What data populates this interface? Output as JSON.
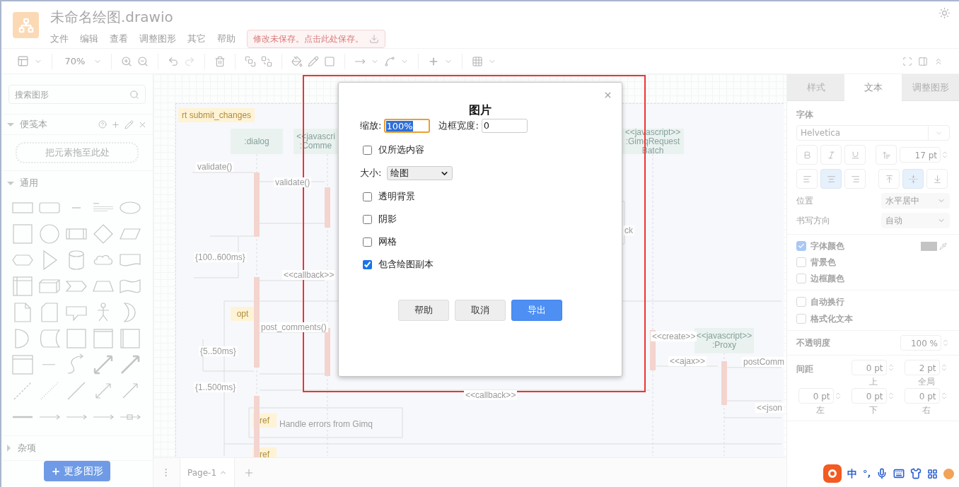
{
  "app": {
    "title": "未命名绘图.drawio",
    "menu": [
      "文件",
      "编辑",
      "查看",
      "调整图形",
      "其它",
      "帮助"
    ],
    "save_notice": "修改未保存。点击此处保存。"
  },
  "toolbar": {
    "zoom": "70%"
  },
  "sidebar": {
    "search": {
      "placeholder": "搜索图形"
    },
    "scratchpad": {
      "title": "便笺本",
      "expanded": true,
      "drop_hint": "把元素拖至此处"
    },
    "sections": [
      {
        "title": "通用",
        "expanded": true
      },
      {
        "title": "杂项",
        "expanded": false
      }
    ],
    "more_shapes": "更多图形"
  },
  "diagram": {
    "frame": "rt submit_changes",
    "participants": [
      {
        "lines": [
          ":dialog"
        ]
      },
      {
        "lines": [
          "<<javascri",
          ":Comme"
        ]
      },
      {
        "lines": [
          "<<javascript>>",
          ":GimqRequest",
          "Batch"
        ]
      },
      {
        "lines": [
          "<<javascript>>",
          ":Proxy"
        ]
      }
    ],
    "fragments": [
      {
        "tag": "opt"
      },
      {
        "tag": "ref",
        "text": "Handle errors from Gimq"
      },
      {
        "tag": "ref"
      }
    ],
    "labels": [
      "validate()",
      "validate()",
      "{100..600ms}",
      "<<callback>>",
      "post_comments()",
      "{5..50ms}",
      "{1..500ms}",
      "<<callback>>",
      "ck",
      "<<create>>",
      "<<ajax>>",
      "postComm",
      "<<json"
    ]
  },
  "pages": [
    {
      "label": "Page-1",
      "selected": true
    }
  ],
  "format_panel": {
    "tabs": [
      {
        "label": "样式",
        "selected": false
      },
      {
        "label": "文本",
        "selected": true
      },
      {
        "label": "调整图形",
        "selected": false
      }
    ],
    "font": {
      "title": "字体",
      "family": "Helvetica",
      "size": "17 pt"
    },
    "align": [
      {
        "kind": "left",
        "selected": false
      },
      {
        "kind": "center",
        "selected": true
      },
      {
        "kind": "right",
        "selected": false
      }
    ],
    "valign": [
      {
        "kind": "top",
        "selected": false
      },
      {
        "kind": "middle",
        "selected": true
      },
      {
        "kind": "bottom",
        "selected": false
      }
    ],
    "position": {
      "label": "位置",
      "value": "水平居中"
    },
    "direction": {
      "label": "书写方向",
      "value": "自动"
    },
    "colors": [
      {
        "label": "字体颜色",
        "checked": true
      },
      {
        "label": "背景色",
        "checked": false
      },
      {
        "label": "边框颜色",
        "checked": false
      }
    ],
    "text_options": [
      {
        "label": "自动换行",
        "checked": false
      },
      {
        "label": "格式化文本",
        "checked": false
      }
    ],
    "opacity": {
      "label": "不透明度",
      "value": "100 %"
    },
    "spacing": {
      "label": "间距",
      "fields": [
        {
          "value": "0 pt",
          "caption": "上"
        },
        {
          "value": "2 pt",
          "caption": "全局"
        },
        {
          "value": "0 pt",
          "caption": "左"
        },
        {
          "value": "0 pt",
          "caption": "下"
        },
        {
          "value": "0 pt",
          "caption": "右"
        }
      ]
    }
  },
  "export_dialog": {
    "title": "图片",
    "scale": {
      "label": "缩放:",
      "value": "100%"
    },
    "border_width": {
      "label": "边框宽度:",
      "value": "0"
    },
    "selection_only": {
      "label": "仅所选内容",
      "checked": false
    },
    "size": {
      "label": "大小:",
      "value": "绘图"
    },
    "options": [
      {
        "label": "透明背景",
        "checked": false
      },
      {
        "label": "阴影",
        "checked": false
      },
      {
        "label": "网格",
        "checked": false
      },
      {
        "label": "包含绘图副本",
        "checked": true
      }
    ],
    "buttons": [
      {
        "label": "帮助",
        "kind": "secondary"
      },
      {
        "label": "取消",
        "kind": "secondary"
      },
      {
        "label": "导出",
        "kind": "primary"
      }
    ]
  },
  "ime": {
    "mode": "中",
    "punctuation": "°,"
  }
}
